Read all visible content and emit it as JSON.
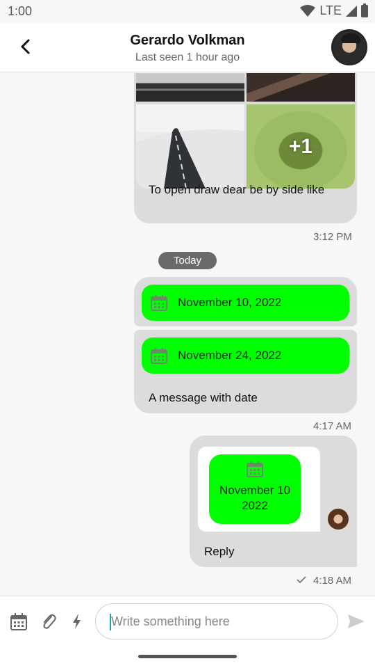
{
  "status": {
    "time": "1:00",
    "network": "LTE"
  },
  "header": {
    "title": "Gerardo Volkman",
    "subtitle": "Last seen 1 hour ago"
  },
  "messages": {
    "image_message": {
      "more_count": "+1",
      "text": "To open draw dear be by side like",
      "time": "3:12 PM"
    },
    "day_separator": "Today",
    "date_message": {
      "dates": [
        "November 10, 2022",
        "November 24, 2022"
      ],
      "text": "A message with date",
      "time": "4:17 AM"
    },
    "reply_message": {
      "quoted_date": "November 10 2022",
      "text": "Reply",
      "time": "4:18 AM"
    }
  },
  "composer": {
    "placeholder": "Write something here"
  },
  "colors": {
    "bubble": "#dcdcdc",
    "date_pill": "#00ff00",
    "day_chip": "#6a6a6a"
  }
}
